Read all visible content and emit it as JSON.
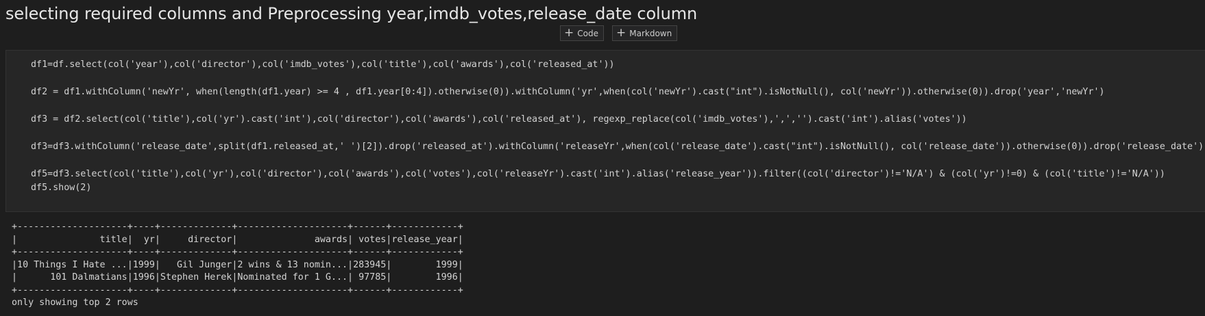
{
  "markdown": {
    "heading": "selecting required columns and Preprocessing year,imdb_votes,release_date column"
  },
  "add_cell_bar": {
    "code_label": "Code",
    "markdown_label": "Markdown"
  },
  "code_cell": {
    "lines": [
      "df1=df.select(col('year'),col('director'),col('imdb_votes'),col('title'),col('awards'),col('released_at'))",
      "",
      "df2 = df1.withColumn('newYr', when(length(df1.year) >= 4 , df1.year[0:4]).otherwise(0)).withColumn('yr',when(col('newYr').cast(\"int\").isNotNull(), col('newYr')).otherwise(0)).drop('year','newYr')",
      "",
      "df3 = df2.select(col('title'),col('yr').cast('int'),col('director'),col('awards'),col('released_at'), regexp_replace(col('imdb_votes'),',','').cast('int').alias('votes'))",
      "",
      "df3=df3.withColumn('release_date',split(df1.released_at,' ')[2]).drop('released_at').withColumn('releaseYr',when(col('release_date').cast(\"int\").isNotNull(), col('release_date')).otherwise(0)).drop('release_date')",
      "",
      "df5=df3.select(col('title'),col('yr'),col('director'),col('awards'),col('votes'),col('releaseYr').cast('int').alias('release_year')).filter((col('director')!='N/A') & (col('yr')!=0) & (col('title')!='N/A'))",
      "df5.show(2)"
    ]
  },
  "output": {
    "lines": [
      "+--------------------+----+-------------+--------------------+------+------------+",
      "|               title|  yr|     director|              awards| votes|release_year|",
      "+--------------------+----+-------------+--------------------+------+------------+",
      "|10 Things I Hate ...|1999|   Gil Junger|2 wins & 13 nomin...|283945|        1999|",
      "|      101 Dalmatians|1996|Stephen Herek|Nominated for 1 G...| 97785|        1996|",
      "+--------------------+----+-------------+--------------------+------+------------+",
      "only showing top 2 rows"
    ]
  }
}
